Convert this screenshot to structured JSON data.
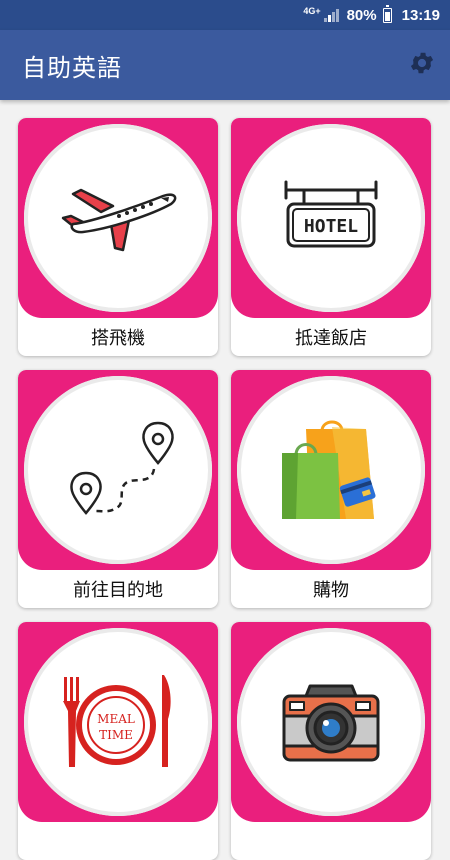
{
  "status": {
    "network": "4G+",
    "battery": "80%",
    "time": "13:19"
  },
  "appbar": {
    "title": "自助英語",
    "settings_icon": "gear-icon"
  },
  "categories": [
    {
      "label": "搭飛機",
      "icon": "airplane-icon"
    },
    {
      "label": "抵達飯店",
      "icon": "hotel-sign-icon",
      "icon_text": "HOTEL"
    },
    {
      "label": "前往目的地",
      "icon": "map-route-icon"
    },
    {
      "label": "購物",
      "icon": "shopping-bags-icon"
    },
    {
      "label": "",
      "icon": "meal-plate-icon",
      "icon_text_1": "MEAL",
      "icon_text_2": "TIME"
    },
    {
      "label": "",
      "icon": "camera-icon"
    }
  ],
  "colors": {
    "appbar": "#3b5a9e",
    "statusbar": "#2b4c8c",
    "card_accent": "#ea1f7d"
  }
}
